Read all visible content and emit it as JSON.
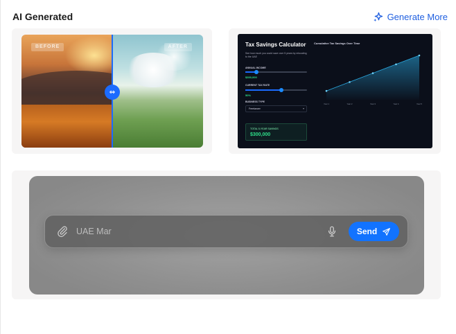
{
  "header": {
    "title": "AI Generated",
    "generate_more": "Generate More",
    "accent": "#1f5fe0"
  },
  "card_before_after": {
    "before_tag": "BEFORE",
    "after_tag": "AFTER",
    "handle_icon": "drag-handle-icon"
  },
  "card_calculator": {
    "title": "Tax Savings Calculator",
    "subtitle": "See how much you could save over 5 years by relocating to the UAE",
    "annual_income_label": "ANNUAL INCOME",
    "annual_income_value": "$300,000",
    "annual_income_level": 0.18,
    "tax_rate_label": "CURRENT TAX RATE",
    "tax_rate_value": "50%",
    "tax_rate_level": 0.58,
    "business_type_label": "BUSINESS TYPE",
    "business_type_value": "Freelancer",
    "total_label": "TOTAL 5-YEAR SAVINGS",
    "total_value": "$300,000",
    "chart_title": "Cumulative Tax Savings Over Time"
  },
  "chart_data": {
    "type": "area",
    "title": "Cumulative Tax Savings Over Time",
    "categories": [
      "Year 1",
      "Year 2",
      "Year 3",
      "Year 4",
      "Year 5"
    ],
    "values": [
      60000,
      120000,
      180000,
      240000,
      300000
    ],
    "ylim": [
      0,
      300000
    ],
    "grid": false,
    "accent": "#2aa8e0"
  },
  "composer": {
    "placeholder": "UAE Mar",
    "send_label": "Send",
    "attach_icon": "paperclip-icon",
    "mic_icon": "microphone-icon",
    "send_icon": "send-icon",
    "send_color": "#1273ff"
  }
}
